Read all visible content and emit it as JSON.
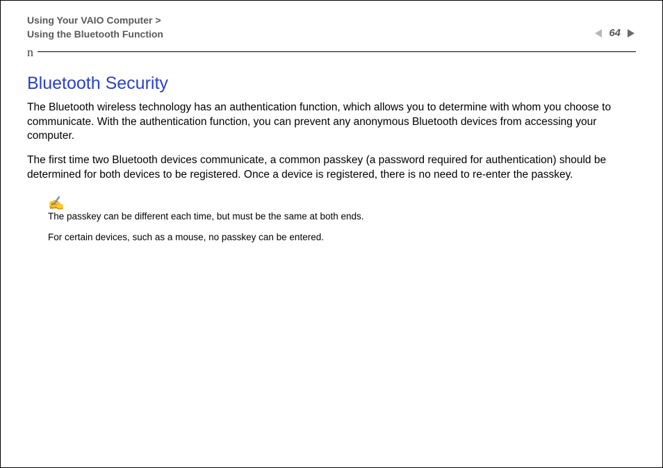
{
  "header": {
    "breadcrumb_line1": "Using Your VAIO Computer >",
    "breadcrumb_line2": "Using the Bluetooth Function",
    "page_number": "64",
    "n_letter": "n"
  },
  "content": {
    "heading": "Bluetooth Security",
    "paragraph1": "The Bluetooth wireless technology has an authentication function, which allows you to determine with whom you choose to communicate. With the authentication function, you can prevent any anonymous Bluetooth devices from accessing your computer.",
    "paragraph2": "The first time two Bluetooth devices communicate, a common passkey (a password required for authentication) should be determined for both devices to be registered. Once a device is registered, there is no need to re-enter the passkey."
  },
  "note": {
    "icon_glyph": "✍",
    "line1": "The passkey can be different each time, but must be the same at both ends.",
    "line2": "For certain devices, such as a mouse, no passkey can be entered."
  }
}
